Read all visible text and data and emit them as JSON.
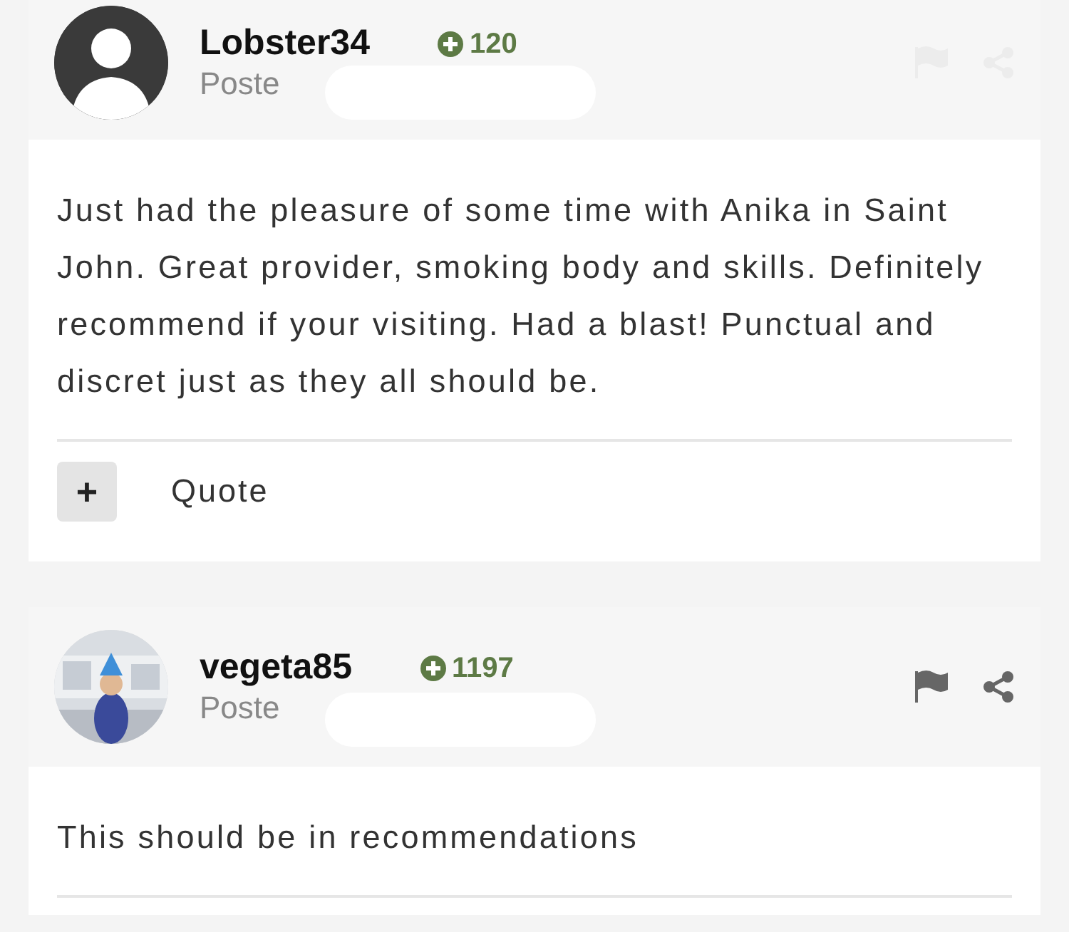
{
  "posts": [
    {
      "author": "Lobster34",
      "avatar": {
        "kind": "silhouette"
      },
      "reputation": "120",
      "posted": "Poste",
      "actions_disabled": true,
      "body": "Just had the pleasure of some time with Anika in Saint John. Great provider, smoking body and skills. Definitely recommend if your visiting. Had a blast! Punctual and discret just as they all should be.",
      "quote_button": "+",
      "quote_label": "Quote"
    },
    {
      "author": "vegeta85",
      "reputation": "1197",
      "posted": "Poste",
      "actions_disabled": false,
      "body": "This should be in recommendations"
    }
  ]
}
